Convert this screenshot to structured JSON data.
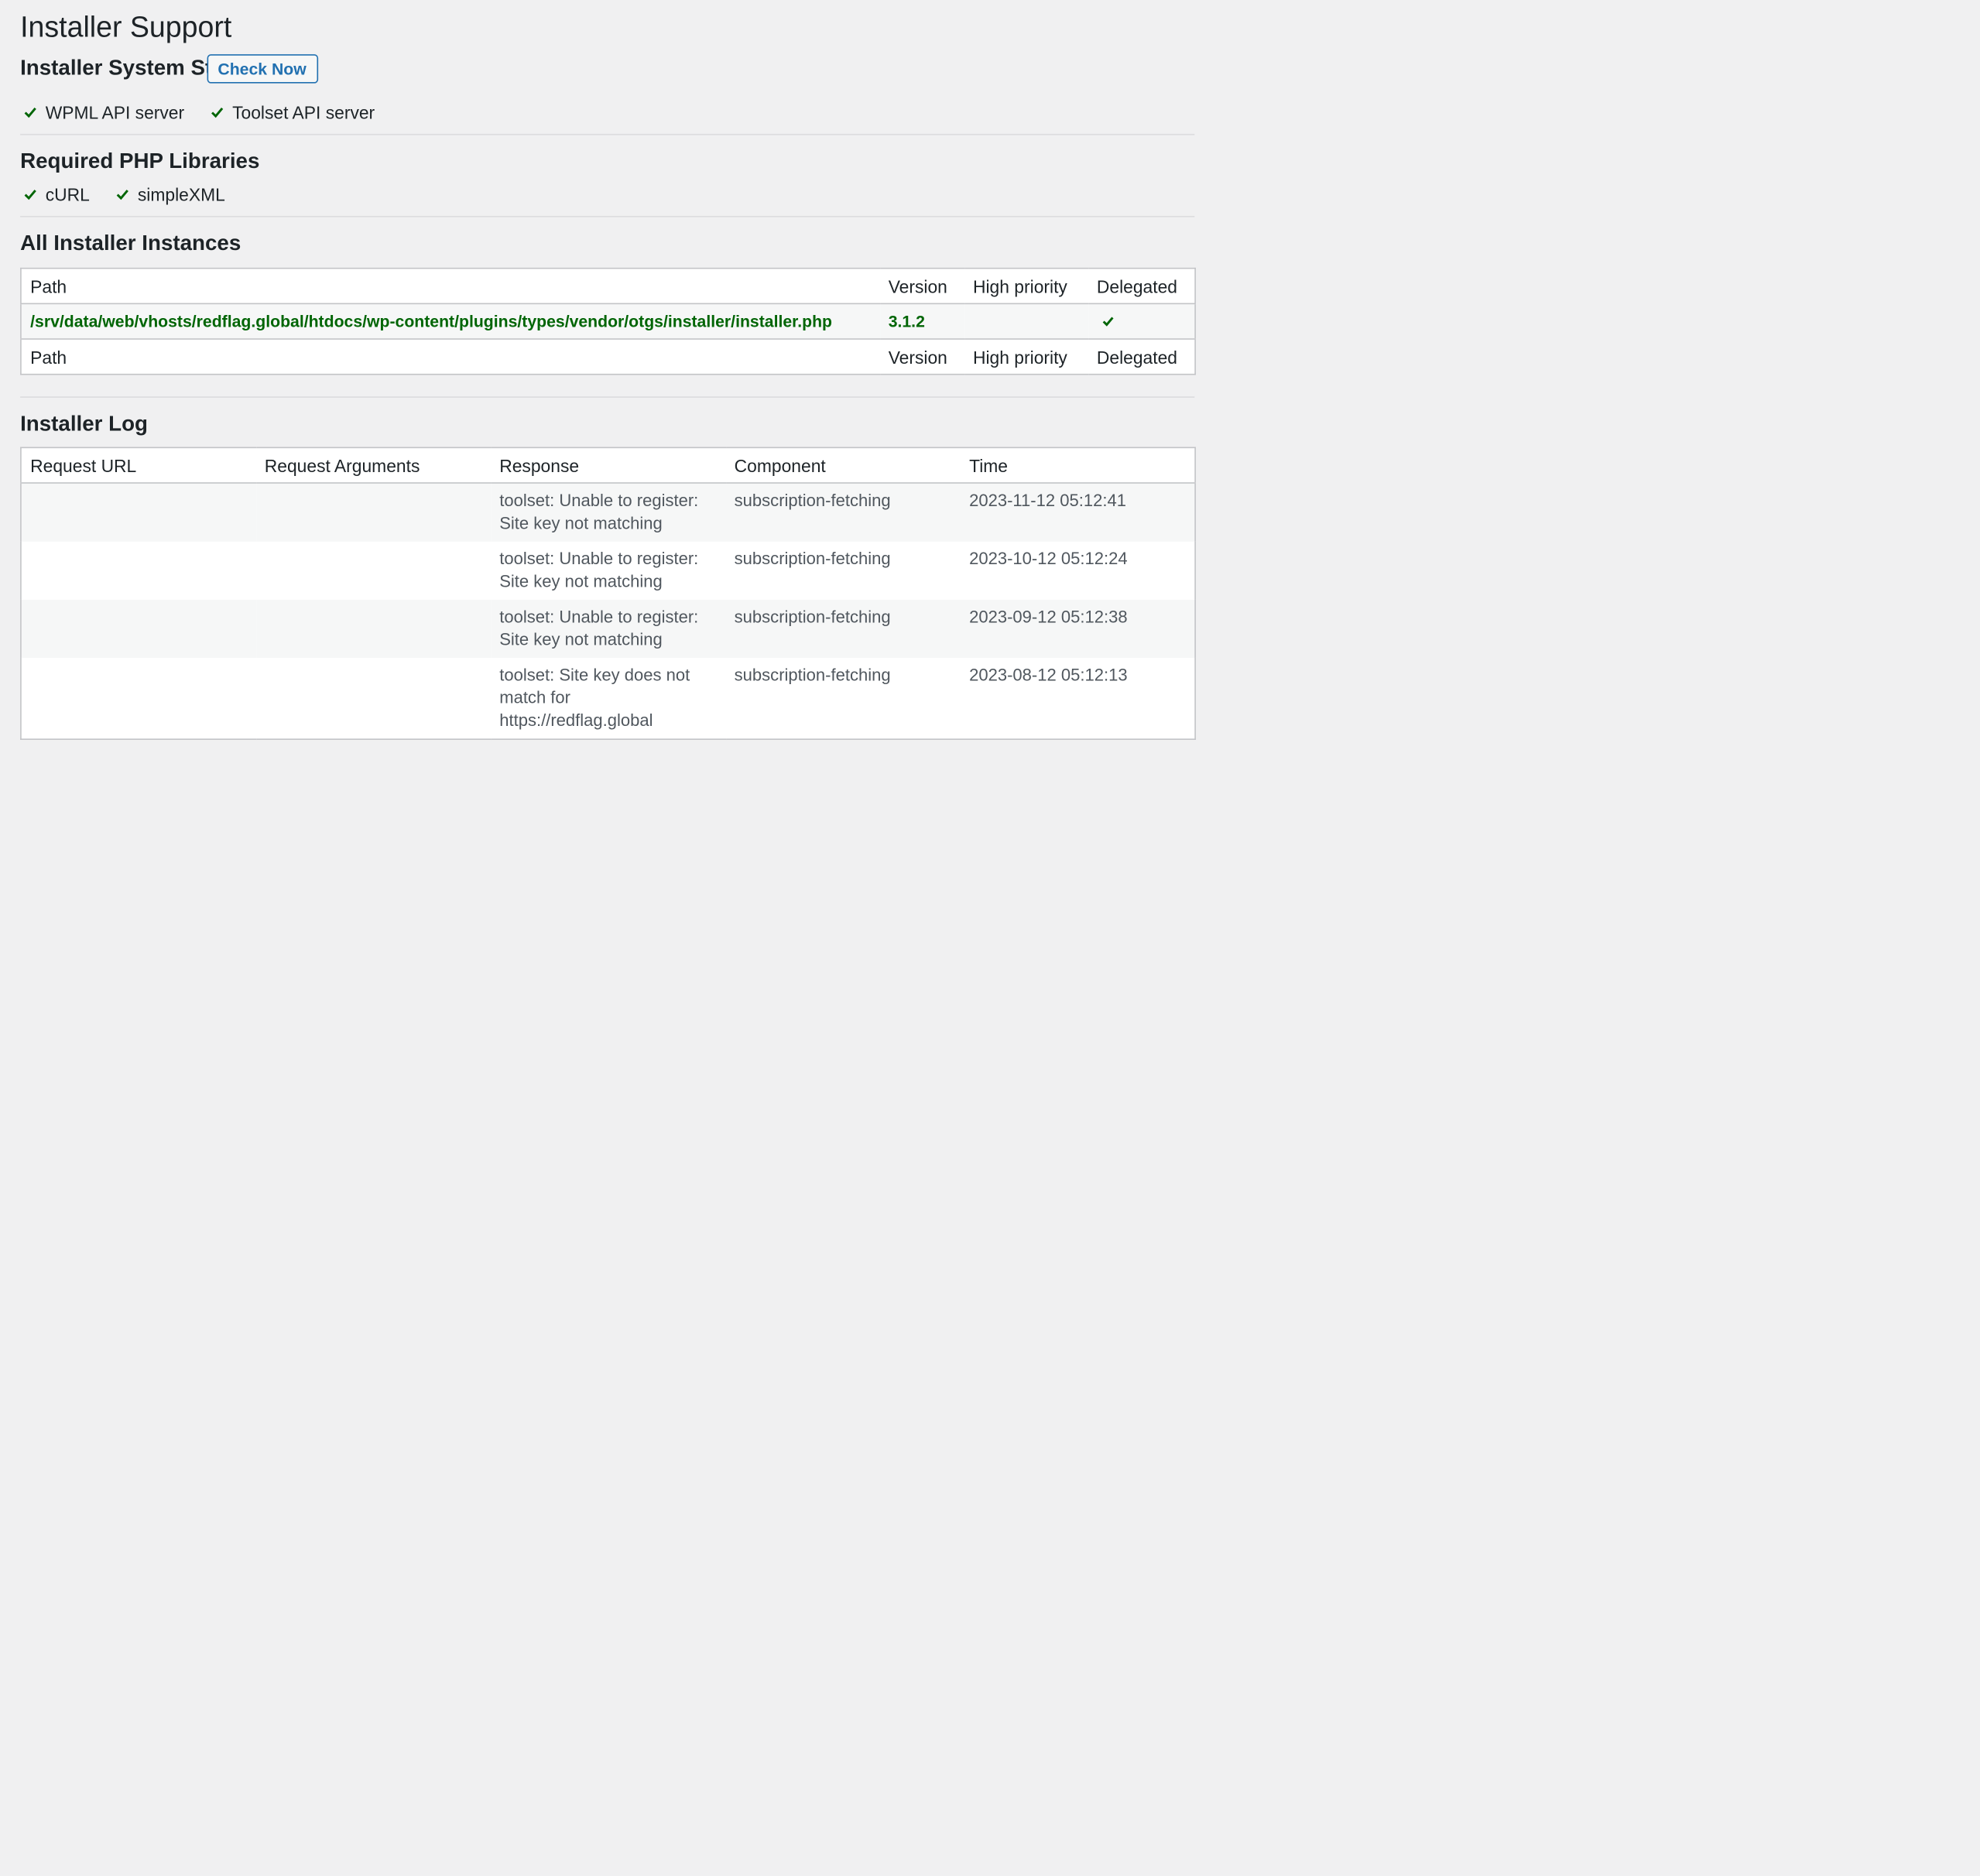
{
  "page": {
    "title": "Installer Support"
  },
  "system_status": {
    "title": "Installer System Status",
    "check_button_label": "Check Now",
    "items": [
      {
        "label": "WPML API server",
        "ok": true
      },
      {
        "label": "Toolset API server",
        "ok": true
      }
    ]
  },
  "php_libraries": {
    "title": "Required PHP Libraries",
    "items": [
      {
        "label": "cURL",
        "ok": true
      },
      {
        "label": "simpleXML",
        "ok": true
      }
    ]
  },
  "instances": {
    "title": "All Installer Instances",
    "columns": {
      "path": "Path",
      "version": "Version",
      "high_priority": "High priority",
      "delegated": "Delegated"
    },
    "rows": [
      {
        "path": "/srv/data/web/vhosts/redflag.global/htdocs/wp-content/plugins/types/vendor/otgs/installer/installer.php",
        "version": "3.1.2",
        "high_priority": "",
        "delegated": true
      }
    ]
  },
  "log": {
    "title": "Installer Log",
    "columns": {
      "request_url": "Request URL",
      "request_arguments": "Request Arguments",
      "response": "Response",
      "component": "Component",
      "time": "Time"
    },
    "rows": [
      {
        "request_url": "",
        "request_arguments": "",
        "response": "toolset: Unable to register: Site key not matching",
        "component": "subscription-fetching",
        "time": "2023-11-12 05:12:41"
      },
      {
        "request_url": "",
        "request_arguments": "",
        "response": "toolset: Unable to register: Site key not matching",
        "component": "subscription-fetching",
        "time": "2023-10-12 05:12:24"
      },
      {
        "request_url": "",
        "request_arguments": "",
        "response": "toolset: Unable to register: Site key not matching",
        "component": "subscription-fetching",
        "time": "2023-09-12 05:12:38"
      },
      {
        "request_url": "",
        "request_arguments": "",
        "response": "toolset: Site key does not match for https://redflag.global",
        "component": "subscription-fetching",
        "time": "2023-08-12 05:12:13"
      }
    ]
  },
  "colors": {
    "accent": "#2271b1",
    "success": "#006505",
    "background": "#f0f0f1"
  }
}
